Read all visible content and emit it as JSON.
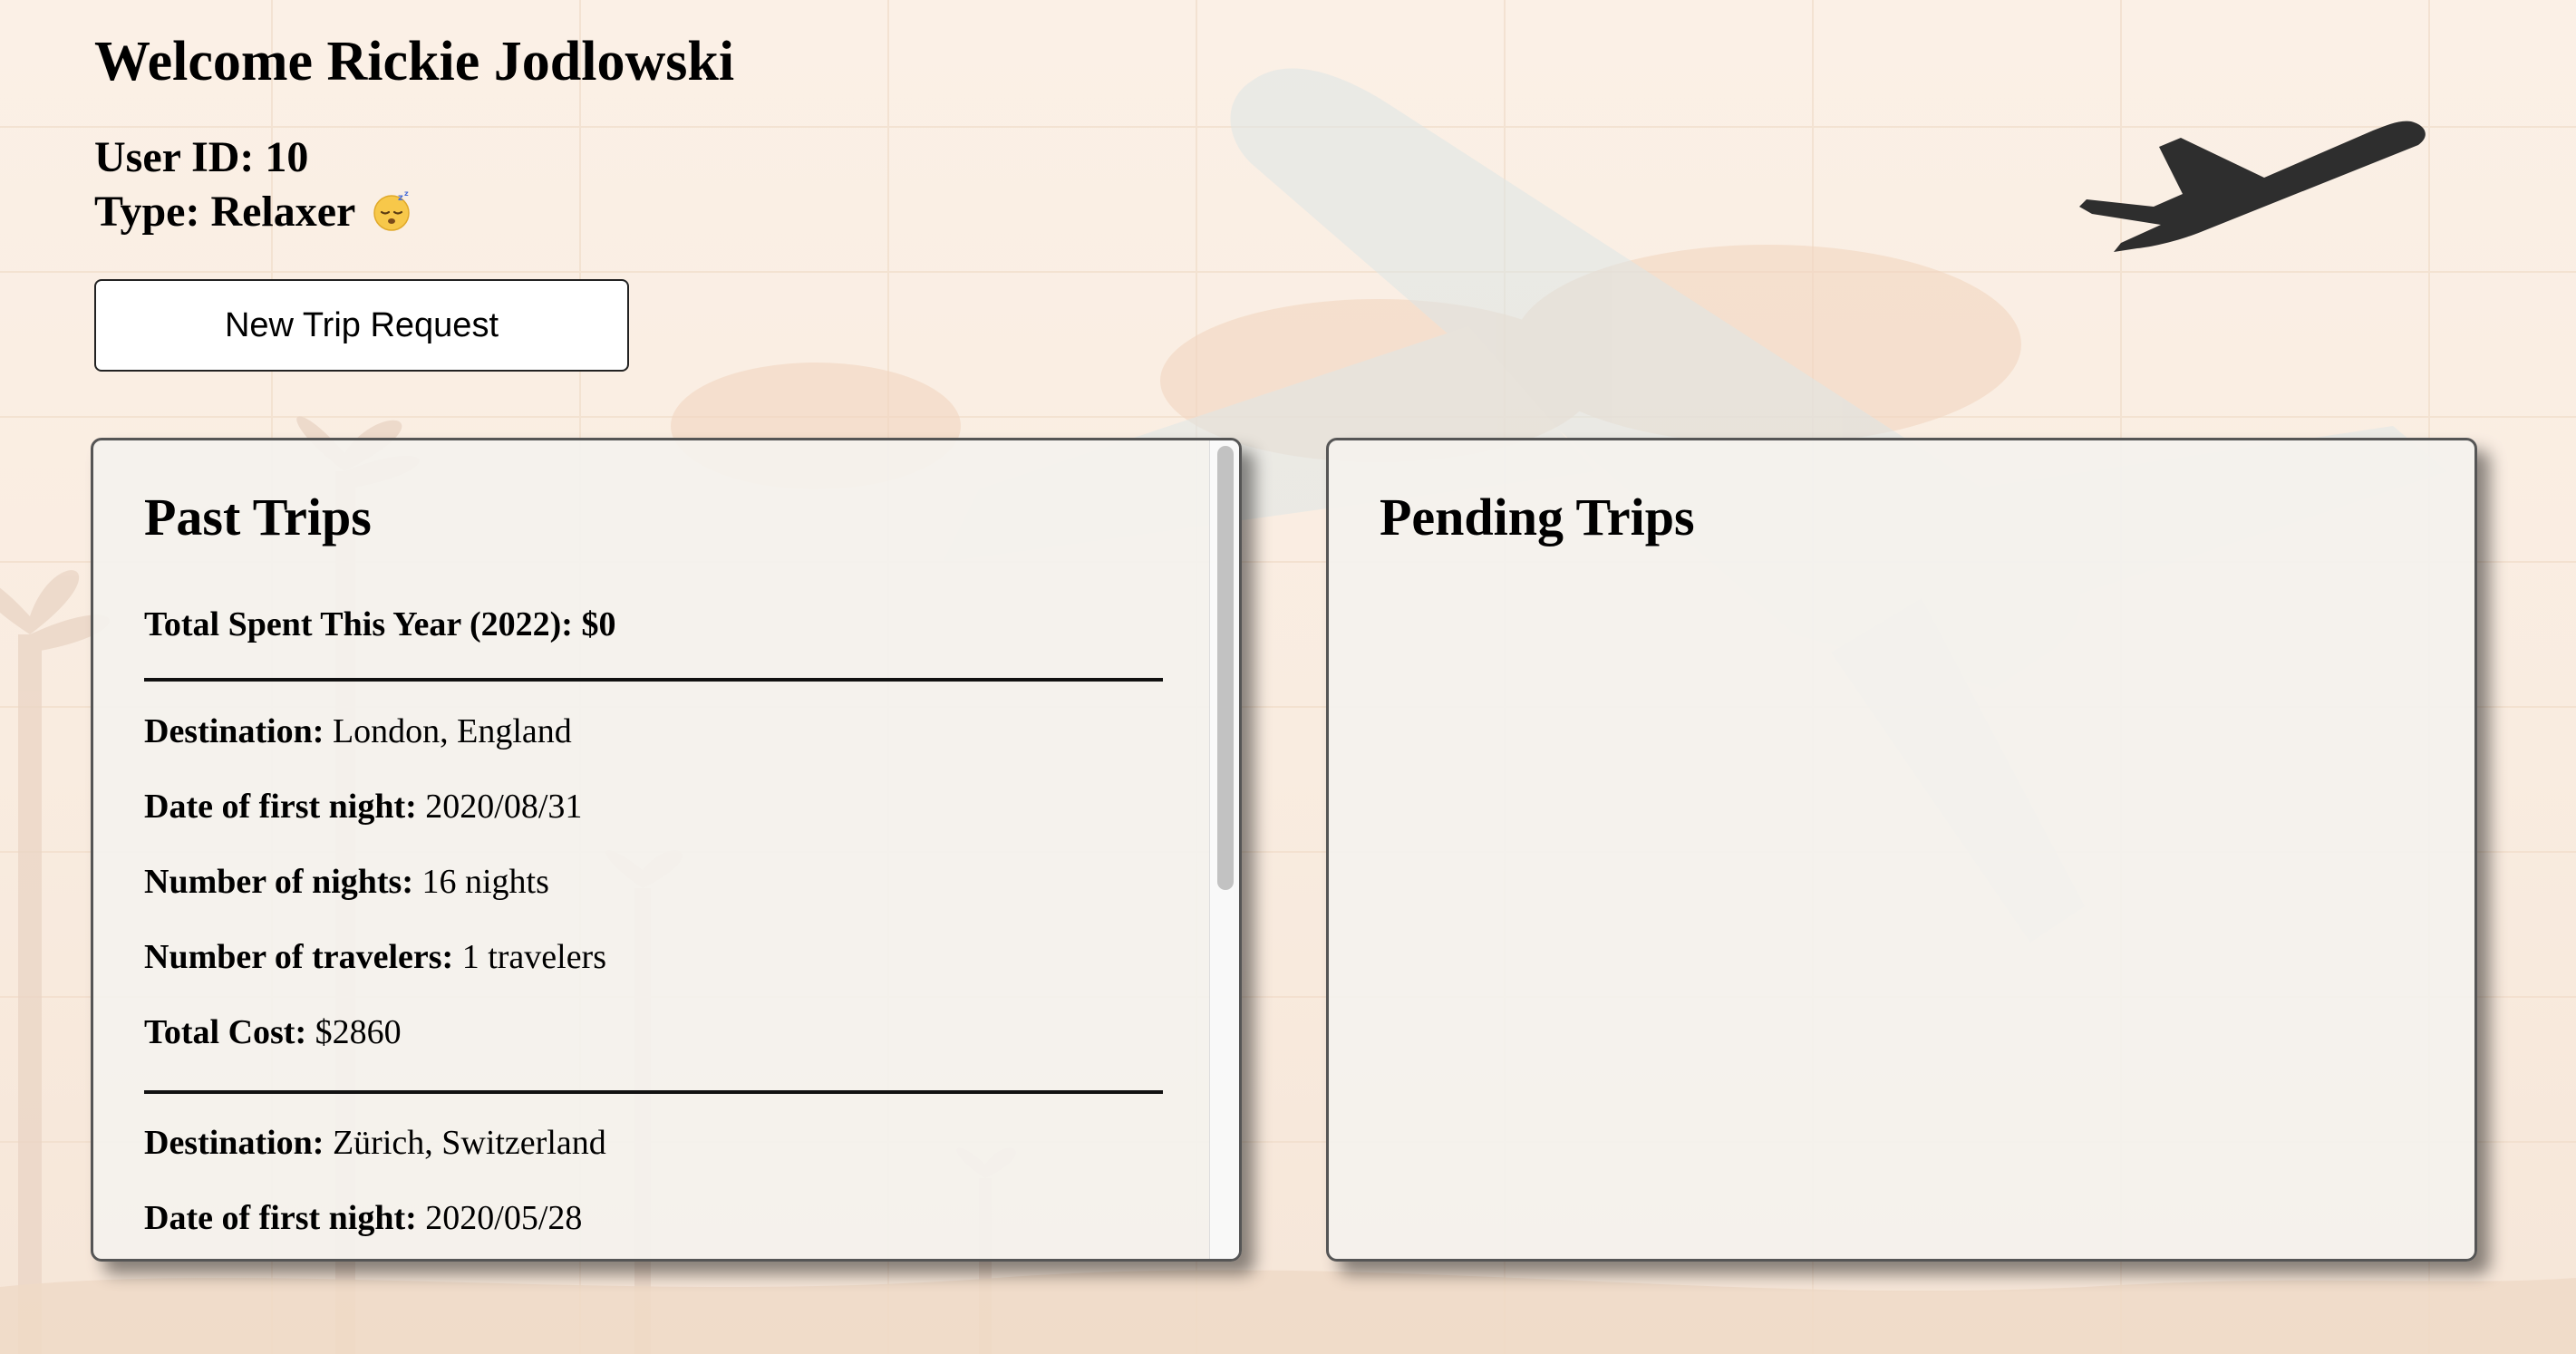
{
  "user": {
    "welcome": "Welcome Rickie Jodlowski",
    "user_id": "User ID: 10",
    "type": "Type: Relaxer"
  },
  "actions": {
    "new_trip_label": "New Trip Request"
  },
  "icons": {
    "header_plane": "airplane-takeoff-icon",
    "type_emoji": "sleeping-face-emoji"
  },
  "past_trips": {
    "title": "Past Trips",
    "total_spent": "Total Spent This Year (2022): $0",
    "field_labels": {
      "destination": "Destination:",
      "date": "Date of first night:",
      "nights": "Number of nights:",
      "travelers": "Number of travelers:",
      "cost": "Total Cost:"
    },
    "trips": [
      {
        "destination": "London, England",
        "date": "2020/08/31",
        "nights": "16 nights",
        "travelers": "1 travelers",
        "cost": "$2860"
      },
      {
        "destination": "Zürich, Switzerland",
        "date": "2020/05/28"
      }
    ]
  },
  "pending_trips": {
    "title": "Pending Trips"
  },
  "colors": {
    "background": "#fbf0e6",
    "panel": "#f4f2ee",
    "panel_border": "#555555",
    "text": "#000000",
    "plane_icon": "#2e2e2e"
  }
}
